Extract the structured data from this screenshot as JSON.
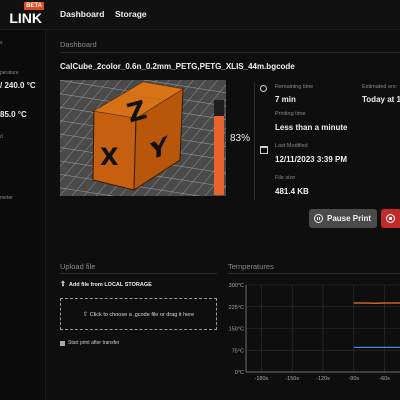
{
  "app": {
    "logo_text": "LINK",
    "beta_badge": "BETA"
  },
  "nav": {
    "dashboard": "Dashboard",
    "storage": "Storage"
  },
  "sidebar": {
    "frag1": "s",
    "frag2": "perature",
    "temp_nozzle": "/ 240.0 °C",
    "temp_bed": "85.0 °C",
    "frag3": "d",
    "frag4": "meter"
  },
  "main": {
    "breadcrumb": "Dashboard",
    "filename": "CalCube_2color_0.6n_0.2mm_PETG,PETG_XLIS_44m.bgcode",
    "progress_percent": 83,
    "progress_label": "83%",
    "info": {
      "remaining_label": "Remaining time",
      "remaining_value": "7 min",
      "estimated_label": "Estimated enc",
      "estimated_value": "Today at 1",
      "printing_label": "Printing time",
      "printing_value": "Less than a minute",
      "modified_label": "Last Modified",
      "modified_value": "12/11/2023 3:39 PM",
      "size_label": "File size",
      "size_value": "481.4 KB"
    },
    "buttons": {
      "pause": "Pause Print"
    }
  },
  "upload": {
    "title": "Upload file",
    "add_label": "Add file from LOCAL STORAGE",
    "drop_text": "Click to choose a .gcode file or drag it here",
    "checkbox_label": "Start print after transfer"
  },
  "temperatures": {
    "title": "Temperatures"
  },
  "colors": {
    "accent": "#e8642c",
    "stop": "#c02a2a",
    "nozzle_series": "#e8742c",
    "bed_series": "#4a7fe8"
  },
  "chart_data": {
    "type": "line",
    "title": "Temperatures",
    "y_ticks": [
      "300°C",
      "225°C",
      "150°C",
      "75°C",
      "0°C"
    ],
    "x_ticks": [
      "-180s",
      "-150s",
      "-120s",
      "-90s",
      "-60s"
    ],
    "ylim": [
      0,
      300
    ],
    "xlim": [
      -195,
      -45
    ],
    "grid": true,
    "series": [
      {
        "color": "#e8742c",
        "x": [
          -90,
          -80,
          -70,
          -60,
          -50,
          -45
        ],
        "values": [
          238,
          238,
          237,
          238,
          238,
          238
        ]
      },
      {
        "color": "#4a7fe8",
        "x": [
          -90,
          -80,
          -70,
          -60,
          -50,
          -45
        ],
        "values": [
          85,
          85,
          85,
          85,
          85,
          85
        ]
      }
    ]
  }
}
